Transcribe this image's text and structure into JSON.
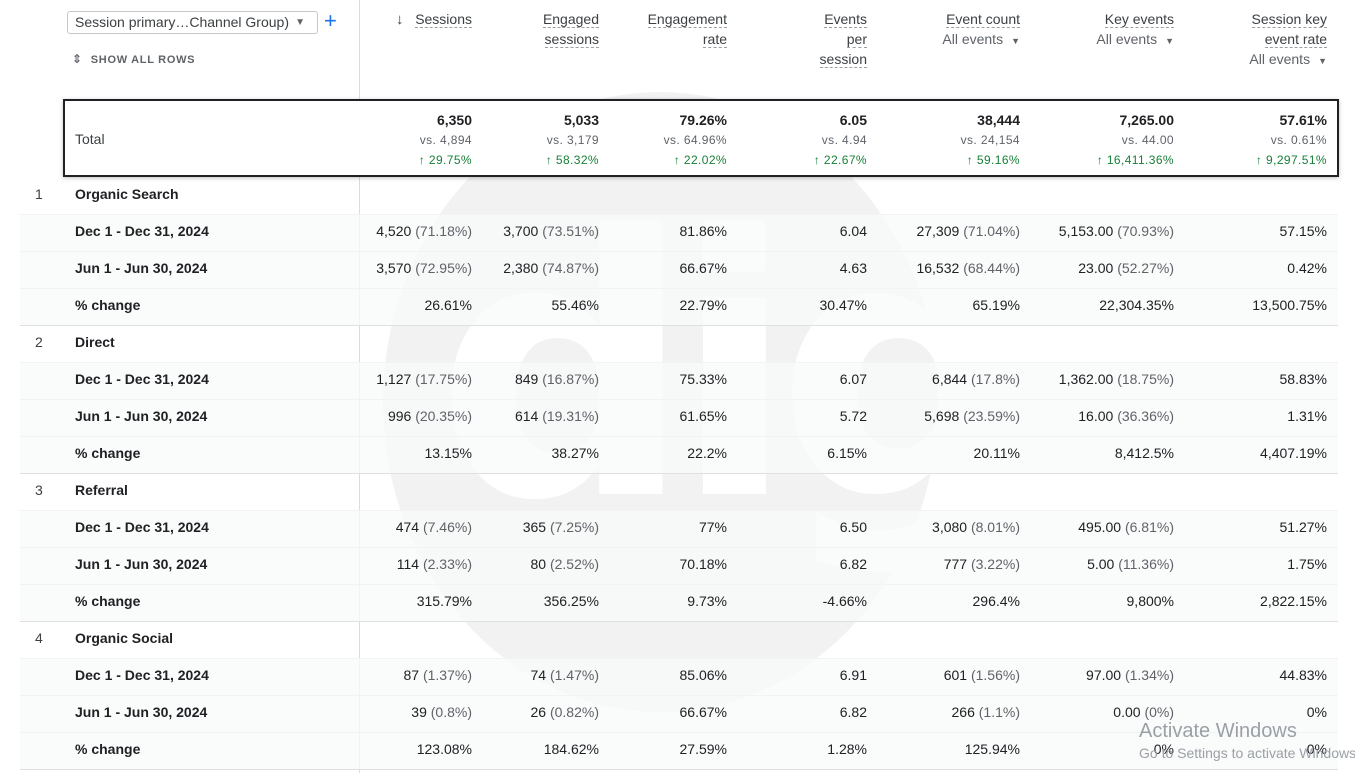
{
  "header": {
    "dimension_select": "Session primary…Channel Group)",
    "show_all_rows": "SHOW ALL ROWS",
    "metrics": [
      {
        "label1": "Sessions",
        "label2": "",
        "label3": "",
        "sub": "",
        "sorted": true
      },
      {
        "label1": "Engaged",
        "label2": "sessions",
        "label3": "",
        "sub": ""
      },
      {
        "label1": "Engagement",
        "label2": "rate",
        "label3": "",
        "sub": ""
      },
      {
        "label1": "Events",
        "label2": "per",
        "label3": "session",
        "sub": ""
      },
      {
        "label1": "Event count",
        "label2": "",
        "label3": "",
        "sub": "All events"
      },
      {
        "label1": "Key events",
        "label2": "",
        "label3": "",
        "sub": "All events"
      },
      {
        "label1": "Session key",
        "label2": "event rate",
        "label3": "",
        "sub": "All events"
      }
    ]
  },
  "total": {
    "label": "Total",
    "values": [
      {
        "v": "6,350",
        "p": "vs. 4,894",
        "d": "↑ 29.75%"
      },
      {
        "v": "5,033",
        "p": "vs. 3,179",
        "d": "↑ 58.32%"
      },
      {
        "v": "79.26%",
        "p": "vs. 64.96%",
        "d": "↑ 22.02%"
      },
      {
        "v": "6.05",
        "p": "vs. 4.94",
        "d": "↑ 22.67%"
      },
      {
        "v": "38,444",
        "p": "vs. 24,154",
        "d": "↑ 59.16%"
      },
      {
        "v": "7,265.00",
        "p": "vs. 44.00",
        "d": "↑ 16,411.36%"
      },
      {
        "v": "57.61%",
        "p": "vs. 0.61%",
        "d": "↑ 9,297.51%"
      }
    ]
  },
  "groups": [
    {
      "num": "1",
      "name": "Organic Search",
      "rows": [
        {
          "label": "Dec 1 - Dec 31, 2024",
          "cells": [
            [
              "4,520",
              "(71.18%)"
            ],
            [
              "3,700",
              "(73.51%)"
            ],
            [
              "81.86%",
              ""
            ],
            [
              "6.04",
              ""
            ],
            [
              "27,309",
              "(71.04%)"
            ],
            [
              "5,153.00",
              "(70.93%)"
            ],
            [
              "57.15%",
              ""
            ]
          ]
        },
        {
          "label": "Jun 1 - Jun 30, 2024",
          "cells": [
            [
              "3,570",
              "(72.95%)"
            ],
            [
              "2,380",
              "(74.87%)"
            ],
            [
              "66.67%",
              ""
            ],
            [
              "4.63",
              ""
            ],
            [
              "16,532",
              "(68.44%)"
            ],
            [
              "23.00",
              "(52.27%)"
            ],
            [
              "0.42%",
              ""
            ]
          ]
        },
        {
          "label": "% change",
          "cells": [
            [
              "26.61%",
              ""
            ],
            [
              "55.46%",
              ""
            ],
            [
              "22.79%",
              ""
            ],
            [
              "30.47%",
              ""
            ],
            [
              "65.19%",
              ""
            ],
            [
              "22,304.35%",
              ""
            ],
            [
              "13,500.75%",
              ""
            ]
          ]
        }
      ]
    },
    {
      "num": "2",
      "name": "Direct",
      "rows": [
        {
          "label": "Dec 1 - Dec 31, 2024",
          "cells": [
            [
              "1,127",
              "(17.75%)"
            ],
            [
              "849",
              "(16.87%)"
            ],
            [
              "75.33%",
              ""
            ],
            [
              "6.07",
              ""
            ],
            [
              "6,844",
              "(17.8%)"
            ],
            [
              "1,362.00",
              "(18.75%)"
            ],
            [
              "58.83%",
              ""
            ]
          ]
        },
        {
          "label": "Jun 1 - Jun 30, 2024",
          "cells": [
            [
              "996",
              "(20.35%)"
            ],
            [
              "614",
              "(19.31%)"
            ],
            [
              "61.65%",
              ""
            ],
            [
              "5.72",
              ""
            ],
            [
              "5,698",
              "(23.59%)"
            ],
            [
              "16.00",
              "(36.36%)"
            ],
            [
              "1.31%",
              ""
            ]
          ]
        },
        {
          "label": "% change",
          "cells": [
            [
              "13.15%",
              ""
            ],
            [
              "38.27%",
              ""
            ],
            [
              "22.2%",
              ""
            ],
            [
              "6.15%",
              ""
            ],
            [
              "20.11%",
              ""
            ],
            [
              "8,412.5%",
              ""
            ],
            [
              "4,407.19%",
              ""
            ]
          ]
        }
      ]
    },
    {
      "num": "3",
      "name": "Referral",
      "rows": [
        {
          "label": "Dec 1 - Dec 31, 2024",
          "cells": [
            [
              "474",
              "(7.46%)"
            ],
            [
              "365",
              "(7.25%)"
            ],
            [
              "77%",
              ""
            ],
            [
              "6.50",
              ""
            ],
            [
              "3,080",
              "(8.01%)"
            ],
            [
              "495.00",
              "(6.81%)"
            ],
            [
              "51.27%",
              ""
            ]
          ]
        },
        {
          "label": "Jun 1 - Jun 30, 2024",
          "cells": [
            [
              "114",
              "(2.33%)"
            ],
            [
              "80",
              "(2.52%)"
            ],
            [
              "70.18%",
              ""
            ],
            [
              "6.82",
              ""
            ],
            [
              "777",
              "(3.22%)"
            ],
            [
              "5.00",
              "(11.36%)"
            ],
            [
              "1.75%",
              ""
            ]
          ]
        },
        {
          "label": "% change",
          "cells": [
            [
              "315.79%",
              ""
            ],
            [
              "356.25%",
              ""
            ],
            [
              "9.73%",
              ""
            ],
            [
              "-4.66%",
              ""
            ],
            [
              "296.4%",
              ""
            ],
            [
              "9,800%",
              ""
            ],
            [
              "2,822.15%",
              ""
            ]
          ]
        }
      ]
    },
    {
      "num": "4",
      "name": "Organic Social",
      "rows": [
        {
          "label": "Dec 1 - Dec 31, 2024",
          "cells": [
            [
              "87",
              "(1.37%)"
            ],
            [
              "74",
              "(1.47%)"
            ],
            [
              "85.06%",
              ""
            ],
            [
              "6.91",
              ""
            ],
            [
              "601",
              "(1.56%)"
            ],
            [
              "97.00",
              "(1.34%)"
            ],
            [
              "44.83%",
              ""
            ]
          ]
        },
        {
          "label": "Jun 1 - Jun 30, 2024",
          "cells": [
            [
              "39",
              "(0.8%)"
            ],
            [
              "26",
              "(0.82%)"
            ],
            [
              "66.67%",
              ""
            ],
            [
              "6.82",
              ""
            ],
            [
              "266",
              "(1.1%)"
            ],
            [
              "0.00",
              "(0%)"
            ],
            [
              "0%",
              ""
            ]
          ]
        },
        {
          "label": "% change",
          "cells": [
            [
              "123.08%",
              ""
            ],
            [
              "184.62%",
              ""
            ],
            [
              "27.59%",
              ""
            ],
            [
              "1.28%",
              ""
            ],
            [
              "125.94%",
              ""
            ],
            [
              "0%",
              ""
            ],
            [
              "0%",
              ""
            ]
          ]
        }
      ]
    }
  ],
  "watermark_text": "digi",
  "activate": {
    "line1": "Activate Windows",
    "line2": "Go to Settings to activate Windows."
  }
}
